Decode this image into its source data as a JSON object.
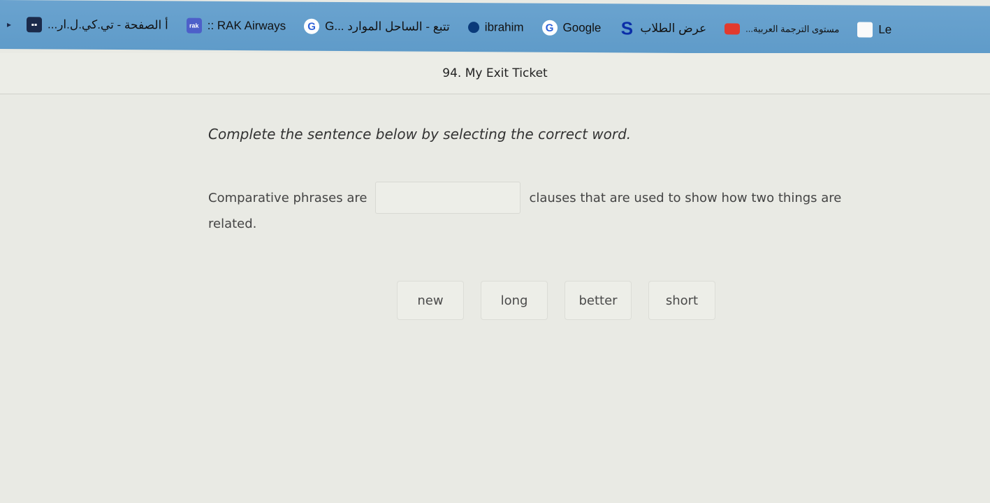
{
  "bookmarks": [
    {
      "icon": "apps-grid-icon",
      "label": "...أ الصفحة - تي.كي.ل.ار"
    },
    {
      "icon": "rak-icon",
      "label": ":: RAK Airways"
    },
    {
      "icon": "google-icon",
      "label": "G... تتبع - الساحل الموارد"
    },
    {
      "icon": "pin-icon",
      "label": "ibrahim"
    },
    {
      "icon": "google-icon",
      "label": "Google"
    },
    {
      "icon": "s-icon",
      "label": "عرض الطلاب"
    },
    {
      "icon": "youtube-icon",
      "label": "...مستوى الترجمة العربية"
    },
    {
      "icon": "bookmark-icon",
      "label": "Le"
    }
  ],
  "page": {
    "title": "94. My Exit Ticket"
  },
  "question": {
    "instruction": "Complete the sentence below by selecting the correct word.",
    "sentence_before": "Comparative phrases are",
    "sentence_after": "clauses that are used to show how two things are",
    "sentence_end": "related."
  },
  "choices": [
    "new",
    "long",
    "better",
    "short"
  ]
}
